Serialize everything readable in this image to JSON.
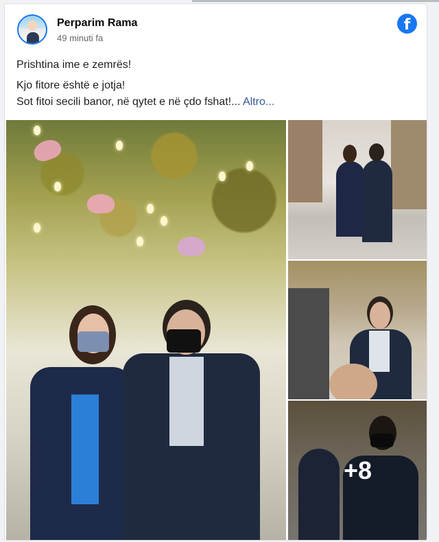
{
  "post": {
    "author": "Perparim Rama",
    "time": "49 minuti fa",
    "lines": [
      "Prishtina ime e zemrës!",
      "Kjo fitore është e jotja!",
      "Sot fitoi secili banor, në qytet e në çdo fshat!..."
    ],
    "see_more": "Altro...",
    "more_photos": "+8"
  },
  "icons": {
    "brand": "facebook-icon",
    "brand_letter": "f"
  },
  "colors": {
    "brand": "#1877f2",
    "link": "#385898",
    "meta": "#65676b"
  }
}
